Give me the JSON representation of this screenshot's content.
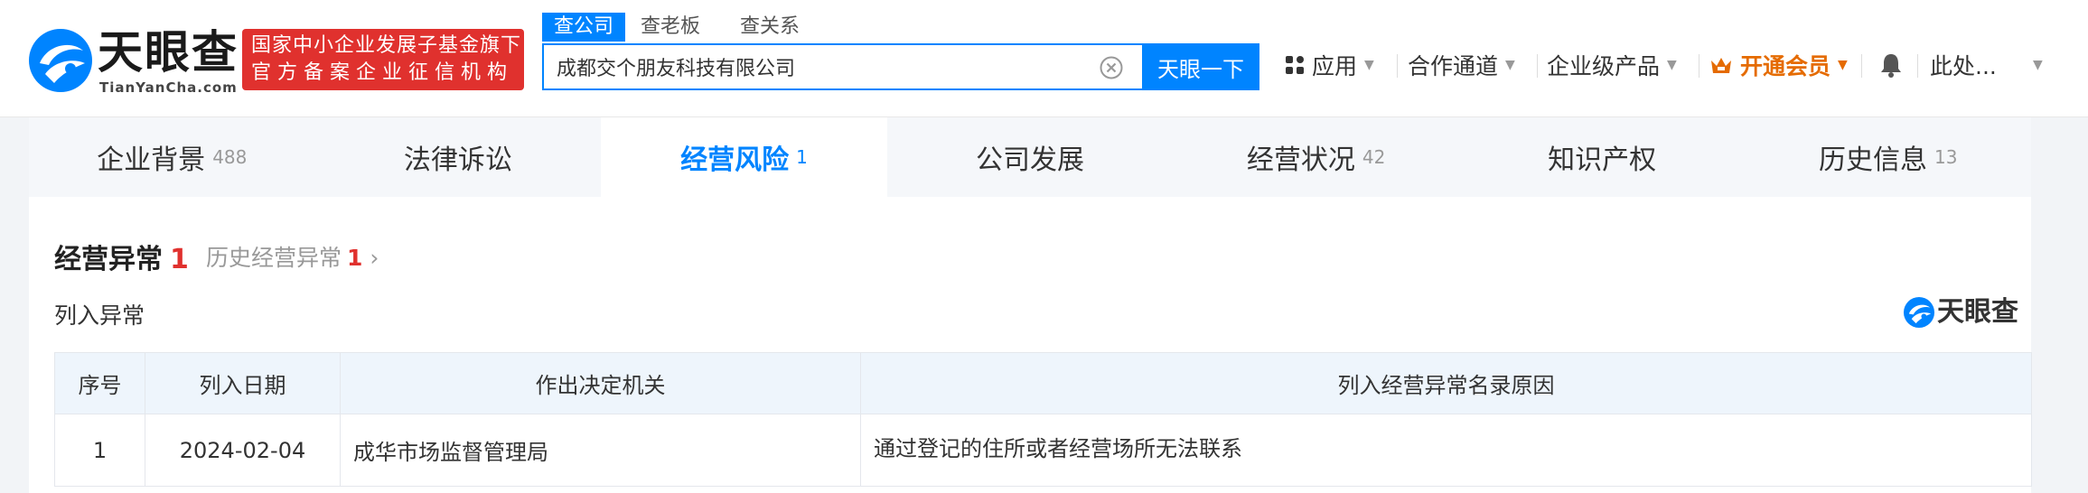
{
  "header": {
    "logo_text": "天眼查",
    "logo_sub": "TianYanCha.com",
    "badge_line1": "国家中小企业发展子基金旗下",
    "badge_line2": "官方备案企业征信机构",
    "search_tabs": [
      "查公司",
      "查老板",
      "查关系"
    ],
    "search_value": "成都交个朋友科技有限公司",
    "search_button": "天眼一下",
    "nav": {
      "apps": "应用",
      "channel": "合作通道",
      "enterprise": "企业级产品",
      "vip": "开通会员",
      "user": "此处..."
    }
  },
  "tabs": [
    {
      "label": "企业背景",
      "count": "488"
    },
    {
      "label": "法律诉讼",
      "count": ""
    },
    {
      "label": "经营风险",
      "count": "1"
    },
    {
      "label": "公司发展",
      "count": ""
    },
    {
      "label": "经营状况",
      "count": "42"
    },
    {
      "label": "知识产权",
      "count": ""
    },
    {
      "label": "历史信息",
      "count": "13"
    }
  ],
  "section": {
    "title": "经营异常",
    "title_count": "1",
    "history_label": "历史经营异常",
    "history_count": "1",
    "subtitle": "列入异常",
    "watermark": "天眼查"
  },
  "table": {
    "headers": [
      "序号",
      "列入日期",
      "作出决定机关",
      "列入经营异常名录原因"
    ],
    "rows": [
      [
        "1",
        "2024-02-04",
        "成华市场监督管理局",
        "通过登记的住所或者经营场所无法联系"
      ]
    ]
  },
  "colors": {
    "brand_blue": "#0084ff",
    "badge_red": "#e0312e",
    "vip_orange": "#e56b00"
  }
}
